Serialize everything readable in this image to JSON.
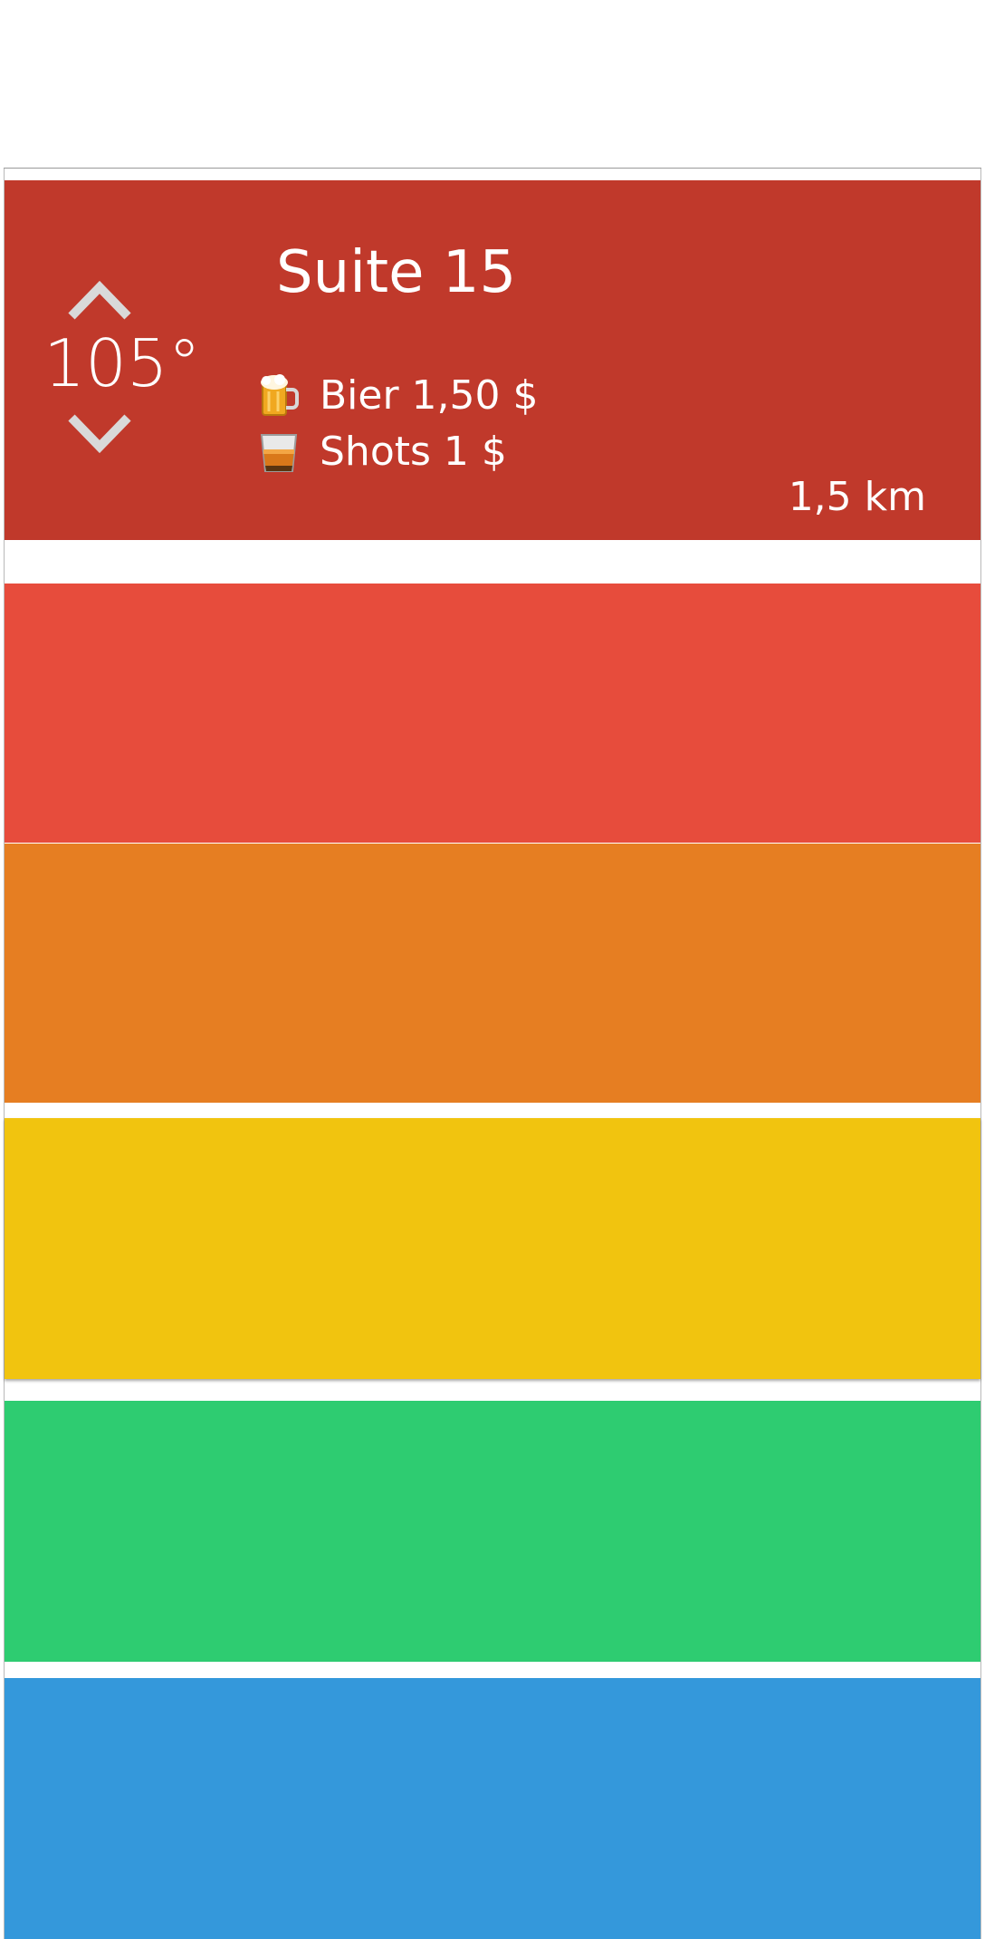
{
  "list": {
    "rows": [
      {
        "color": "#c0392b",
        "temperature": "105°",
        "name": "Suite 15",
        "drinks": [
          {
            "icon": "beer-mug-icon",
            "label": "Bier 1,50 $"
          },
          {
            "icon": "whiskey-glass-icon",
            "label": "Shots 1 $"
          }
        ],
        "distance": "1,5 km"
      },
      {
        "color": "#e74c3c"
      },
      {
        "color": "#e67e22"
      },
      {
        "color": "#f1c40f"
      },
      {
        "color": "#2ecc71"
      },
      {
        "color": "#3498db"
      }
    ]
  }
}
